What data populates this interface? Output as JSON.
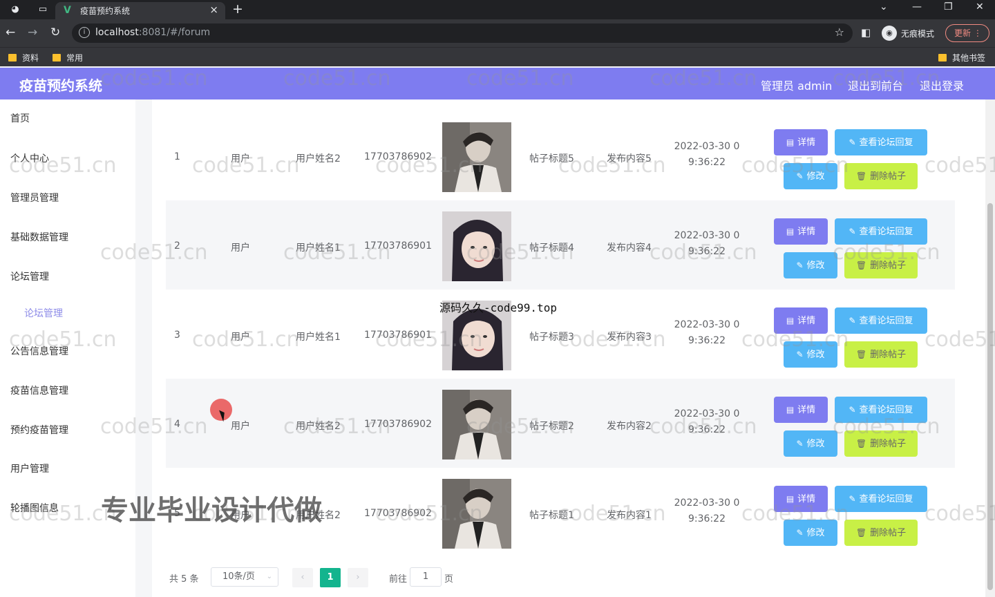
{
  "browser": {
    "tab_title": "疫苗预约系统",
    "tab_favicon": "V",
    "url_host": "localhost",
    "url_rest": ":8081/#/forum",
    "incognito_label": "无痕模式",
    "update_label": "更新",
    "bookmarks": [
      "资料",
      "常用"
    ],
    "other_bookmarks": "其他书签"
  },
  "header": {
    "title": "疫苗预约系统",
    "admin_label": "管理员 admin",
    "front_link": "退出到前台",
    "logout_link": "退出登录",
    "accent_color": "#7e7cf0"
  },
  "sidebar": {
    "items": [
      "首页",
      "个人中心",
      "管理员管理",
      "基础数据管理",
      "论坛管理",
      "公告信息管理",
      "疫苗信息管理",
      "预约疫苗管理",
      "用户管理",
      "轮播图信息"
    ],
    "sub_item": "论坛管理"
  },
  "table": {
    "rows": [
      {
        "index": "1",
        "role": "用户",
        "name": "用户姓名2",
        "phone": "17703786902",
        "avatar": "male-portrait",
        "post_title": "帖子标题5",
        "content": "发布内容5",
        "time_line1": "2022-03-30 0",
        "time_line2": "9:36:22"
      },
      {
        "index": "2",
        "role": "用户",
        "name": "用户姓名1",
        "phone": "17703786901",
        "avatar": "female-portrait",
        "post_title": "帖子标题4",
        "content": "发布内容4",
        "time_line1": "2022-03-30 0",
        "time_line2": "9:36:22"
      },
      {
        "index": "3",
        "role": "用户",
        "name": "用户姓名1",
        "phone": "17703786901",
        "avatar": "female-portrait",
        "post_title": "帖子标题3",
        "content": "发布内容3",
        "time_line1": "2022-03-30 0",
        "time_line2": "9:36:22"
      },
      {
        "index": "4",
        "role": "用户",
        "name": "用户姓名2",
        "phone": "17703786902",
        "avatar": "male-portrait",
        "post_title": "帖子标题2",
        "content": "发布内容2",
        "time_line1": "2022-03-30 0",
        "time_line2": "9:36:22"
      },
      {
        "index": "5",
        "role": "用户",
        "name": "用户姓名2",
        "phone": "17703786902",
        "avatar": "male-portrait",
        "post_title": "帖子标题1",
        "content": "发布内容1",
        "time_line1": "2022-03-30 0",
        "time_line2": "9:36:22"
      }
    ],
    "buttons": {
      "detail": "详情",
      "view_replies": "查看论坛回复",
      "edit": "修改",
      "delete": "删除帖子"
    }
  },
  "pagination": {
    "total": "共 5 条",
    "page_size": "10条/页",
    "current_page": "1",
    "goto_label": "前往",
    "goto_value": "1",
    "goto_suffix": "页"
  },
  "watermarks": {
    "site": "code51.cn",
    "promo": "专业毕业设计代做",
    "source": "源码久久-code99.top"
  }
}
